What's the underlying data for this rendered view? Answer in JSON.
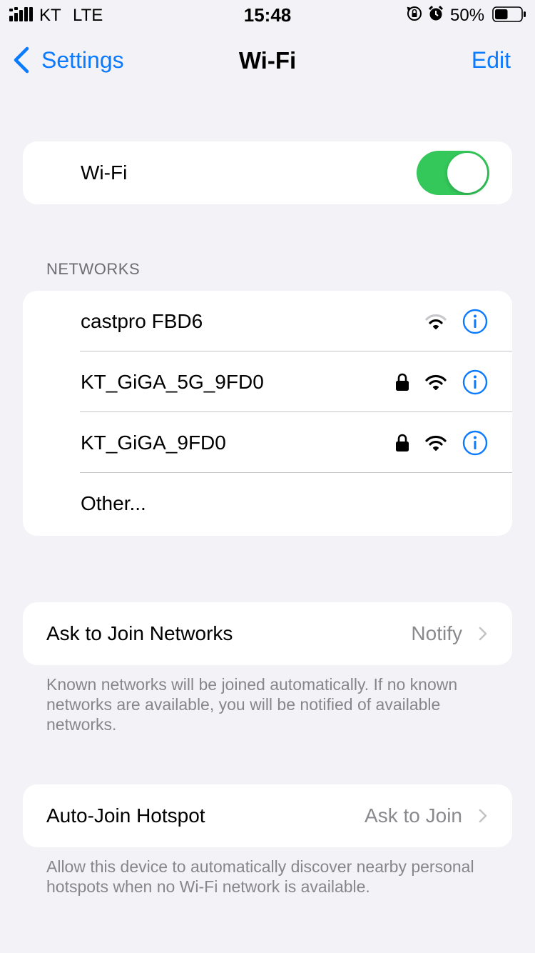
{
  "status_bar": {
    "carrier": "KT",
    "network": "LTE",
    "time": "15:48",
    "battery_percent": "50%",
    "battery_level": 0.5,
    "icons": [
      "signal-bars-icon",
      "orientation-lock-icon",
      "alarm-icon",
      "battery-icon"
    ]
  },
  "nav": {
    "back_label": "Settings",
    "title": "Wi-Fi",
    "edit_label": "Edit"
  },
  "wifi_toggle": {
    "label": "Wi-Fi",
    "on": true
  },
  "networks": {
    "header": "NETWORKS",
    "items": [
      {
        "name": "castpro FBD6",
        "locked": false
      },
      {
        "name": "KT_GiGA_5G_9FD0",
        "locked": true
      },
      {
        "name": "KT_GiGA_9FD0",
        "locked": true
      }
    ],
    "other_label": "Other..."
  },
  "ask_to_join": {
    "label": "Ask to Join Networks",
    "value": "Notify",
    "footnote": "Known networks will be joined automatically. If no known networks are available, you will be notified of available networks."
  },
  "auto_join_hotspot": {
    "label": "Auto-Join Hotspot",
    "value": "Ask to Join",
    "footnote": "Allow this device to automatically discover nearby personal hotspots when no Wi-Fi network is available."
  },
  "colors": {
    "accent": "#0a7aff",
    "toggle_on": "#34c759",
    "background": "#f2f2f7",
    "secondary_text": "#8a8a8e"
  }
}
